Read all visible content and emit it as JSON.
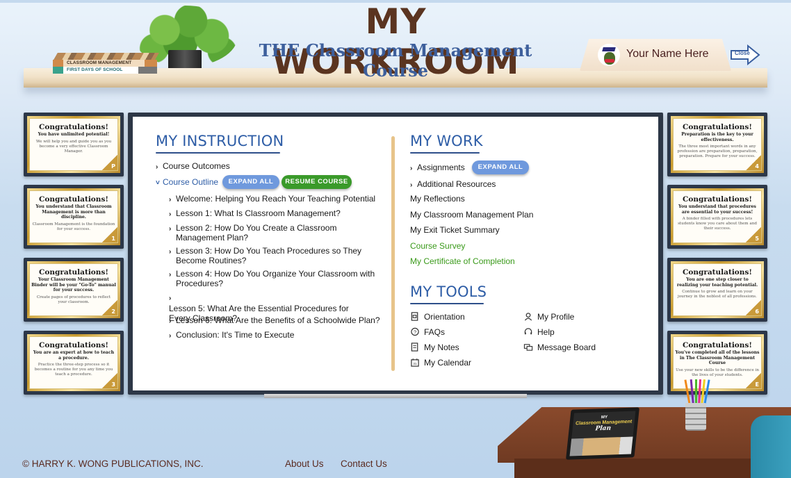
{
  "header": {
    "title": "MY WORKROOM",
    "subtitle": "THE Classroom Management Course",
    "user_name": "Your Name Here",
    "close_label": "Close",
    "books": [
      "CLASSROOM MANAGEMENT",
      "FIRST DAYS OF SCHOOL"
    ]
  },
  "certificates": {
    "left": [
      {
        "title": "Congratulations!",
        "headline": "You have unlimited potential!",
        "body": "We will help you and guide you as you become a very effective Classroom Manager.",
        "badge": "P"
      },
      {
        "title": "Congratulations!",
        "headline": "You understand that Classroom Management is more than discipline.",
        "body": "Classroom Management is the foundation for your success.",
        "badge": "1"
      },
      {
        "title": "Congratulations!",
        "headline": "Your Classroom Management Binder will be your \"Go-To\" manual for your success.",
        "body": "Create pages of procedures to reflect your classroom.",
        "badge": "2"
      },
      {
        "title": "Congratulations!",
        "headline": "You are an expert at how to teach a procedure.",
        "body": "Practice the three-step process so it becomes a routine for you any time you teach a procedure.",
        "badge": "3"
      }
    ],
    "right": [
      {
        "title": "Congratulations!",
        "headline": "Preparation is the key to your effectiveness.",
        "body": "The three most important words in any profession are preparation, preparation, preparation. Prepare for your success.",
        "badge": "4"
      },
      {
        "title": "Congratulations!",
        "headline": "You understand that procedures are essential to your success!",
        "body": "A binder filled with procedures lets students know you care about them and their success.",
        "badge": "5"
      },
      {
        "title": "Congratulations!",
        "headline": "You are one step closer to realizing your teaching potential.",
        "body": "Continue to grow and learn on your journey in the noblest of all professions.",
        "badge": "6"
      },
      {
        "title": "Congratulations!",
        "headline": "You've completed all of the lessons in The Classroom Management Course",
        "body": "Use your new skills to be the difference in the lives of your students.",
        "badge": "E"
      }
    ]
  },
  "instruction": {
    "title": "MY INSTRUCTION",
    "course_outcomes": "Course Outcomes",
    "course_outline": "Course Outline",
    "expand_all": "EXPAND ALL",
    "resume_course": "RESUME COURSE",
    "lessons": [
      "Welcome:  Helping You Reach Your Teaching Potential",
      "Lesson 1:  What Is Classroom Management?",
      "Lesson 2:  How Do You Create a Classroom Management Plan?",
      "Lesson 3:  How Do You Teach Procedures so They Become Routines?",
      "Lesson 4:  How Do You Organize Your Classroom with Procedures?",
      "Lesson 5:  What Are the Essential Procedures for Every Classroom?",
      "Lesson 6:  What Are the Benefits of a Schoolwide Plan?",
      "Conclusion:  It's Time to Execute"
    ]
  },
  "work": {
    "title": "MY WORK",
    "assignments": "Assignments",
    "expand_all": "EXPAND ALL",
    "additional_resources": "Additional Resources",
    "reflections": "My Reflections",
    "plan": "My Classroom Management Plan",
    "exit_ticket": "My Exit Ticket Summary",
    "survey": "Course Survey",
    "certificate": "My Certificate of Completion"
  },
  "tools": {
    "title": "MY TOOLS",
    "items": [
      {
        "label": "Orientation",
        "icon": "orientation-icon"
      },
      {
        "label": "FAQs",
        "icon": "faq-icon"
      },
      {
        "label": "My Notes",
        "icon": "notes-icon"
      },
      {
        "label": "My Calendar",
        "icon": "calendar-icon"
      },
      {
        "label": "My Profile",
        "icon": "profile-icon"
      },
      {
        "label": "Help",
        "icon": "headset-icon"
      },
      {
        "label": "Message Board",
        "icon": "message-board-icon"
      }
    ]
  },
  "desk": {
    "binder_my": "MY",
    "binder_title": "Classroom Management",
    "binder_plan": "Plan"
  },
  "footer": {
    "copyright": "© HARRY K. WONG PUBLICATIONS, INC.",
    "about": "About Us",
    "contact": "Contact Us"
  },
  "colors": {
    "accent_blue": "#2e5da6",
    "title_brown": "#5a3420",
    "green": "#3a9a1a",
    "pill_blue": "#6f99dd",
    "pill_green": "#3a9a2a"
  }
}
